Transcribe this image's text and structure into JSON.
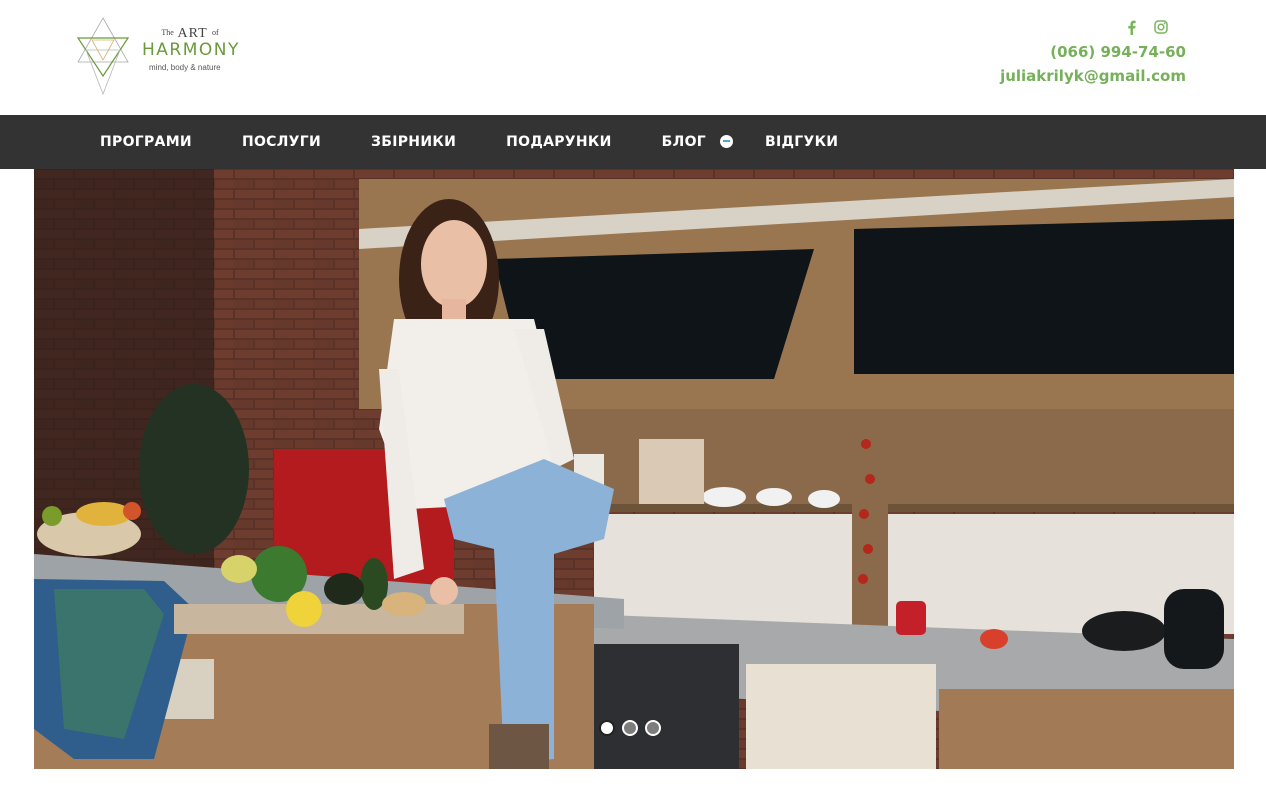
{
  "logo": {
    "line1_the": "The",
    "line1_art": "ART",
    "line1_of": "of",
    "line2": "HARMONY",
    "tagline": "mind, body & nature"
  },
  "contact": {
    "facebook_icon": "facebook-icon",
    "instagram_icon": "instagram-icon",
    "phone": "(066) 994-74-60",
    "email": "juliakrilyk@gmail.com"
  },
  "nav": {
    "items": [
      "ПРОГРАМИ",
      "ПОСЛУГИ",
      "ЗБІРНИКИ",
      "ПОДАРУНКИ",
      "БЛОГ",
      "ВІДГУКИ"
    ]
  },
  "colors": {
    "accent_green": "#76b05a",
    "nav_background": "#333333"
  },
  "slider": {
    "slide_count": 3,
    "active_slide": 1
  }
}
